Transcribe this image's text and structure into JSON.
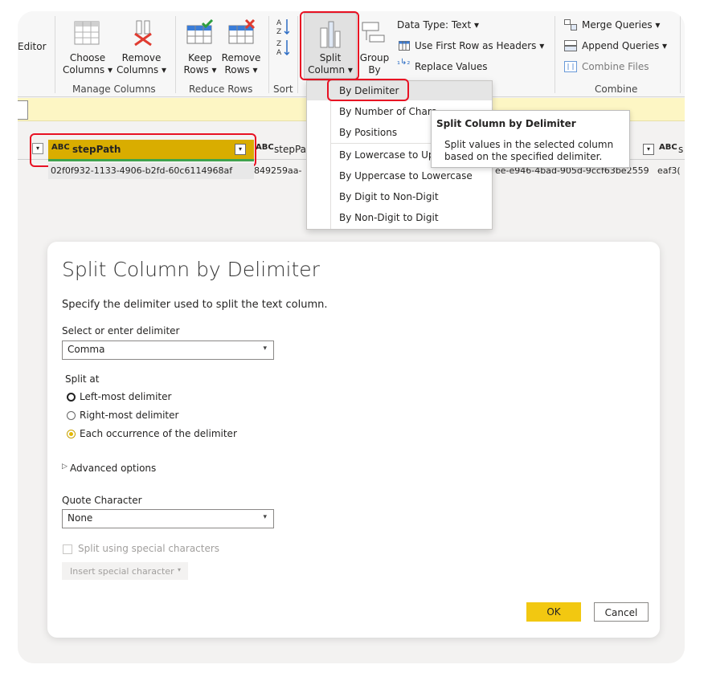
{
  "ribbon": {
    "editor_label": "Editor",
    "choose_columns": "Choose\nColumns ▾",
    "remove_columns": "Remove\nColumns ▾",
    "keep_rows": "Keep\nRows ▾",
    "remove_rows": "Remove\nRows ▾",
    "split_column": "Split\nColumn ▾",
    "group_by": "Group\nBy",
    "data_type": "Data Type: Text ▾",
    "use_first_row": "Use First Row as Headers ▾",
    "replace_values": "Replace Values",
    "merge_queries": "Merge Queries ▾",
    "append_queries": "Append Queries ▾",
    "combine_files": "Combine Files",
    "groups": {
      "manage_columns": "Manage Columns",
      "reduce_rows": "Reduce Rows",
      "sort": "Sort",
      "combine": "Combine"
    }
  },
  "grid": {
    "col1_header": "stepPath",
    "col2_header": "stepPa",
    "col3_header": "s",
    "row1": {
      "c1": "02f0f932-1133-4906-b2fd-60c6114968af",
      "c2": "849259aa-",
      "c3": "ee-e946-4bad-905d-9ccf63be2559",
      "c4": "eaf3("
    },
    "type_icon": "ABC"
  },
  "split_menu": {
    "items": [
      "By Delimiter",
      "By Number of Chara",
      "By Positions",
      "By Lowercase to Up",
      "By Uppercase to Lowercase",
      "By Digit to Non-Digit",
      "By Non-Digit to Digit"
    ]
  },
  "tooltip": {
    "title": "Split Column by Delimiter",
    "line1": "Split values in the selected column",
    "line2": "based on the specified delimiter."
  },
  "dialog": {
    "title": "Split Column by Delimiter",
    "description": "Specify the delimiter used to split the text column.",
    "delimiter_label": "Select or enter delimiter",
    "delimiter_value": "Comma",
    "split_at_label": "Split at",
    "options": [
      "Left-most delimiter",
      "Right-most delimiter",
      "Each occurrence of the delimiter"
    ],
    "advanced": "Advanced options",
    "quote_label": "Quote Character",
    "quote_value": "None",
    "special_chars": "Split using special characters",
    "insert_special": "Insert special character",
    "ok": "OK",
    "cancel": "Cancel"
  },
  "colors": {
    "accent_yellow": "#f2c811",
    "highlight_red": "#e81123",
    "column_header_selected": "#d9ad00"
  }
}
